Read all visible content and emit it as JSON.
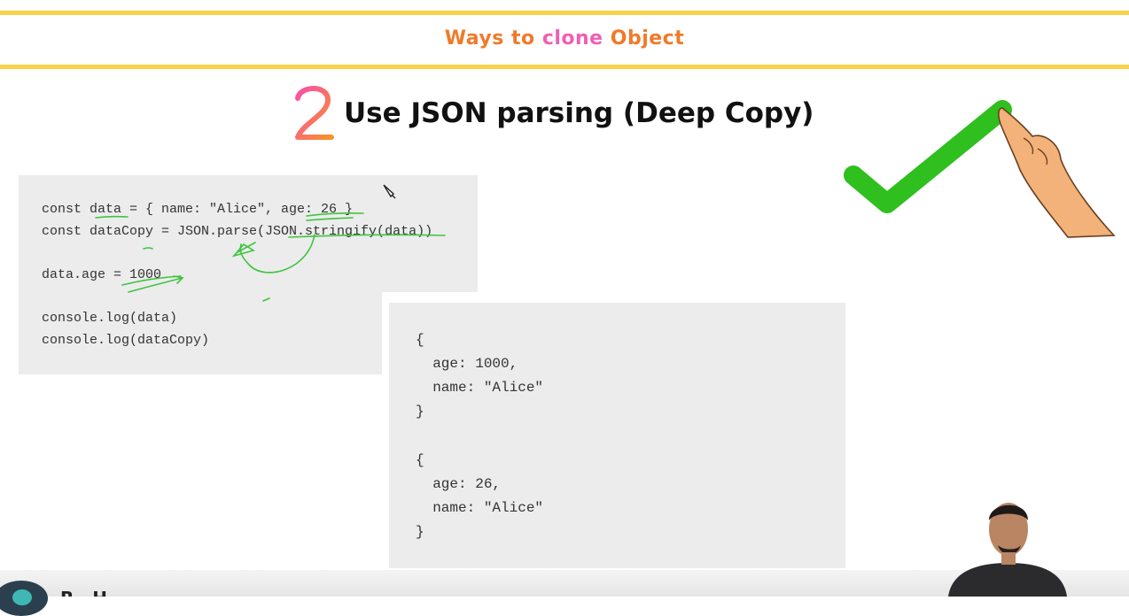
{
  "header": {
    "title_pre": "Ways to ",
    "title_accent": "clone",
    "title_post": " Object"
  },
  "slide": {
    "number_icon": "number-two-icon",
    "heading": "Use JSON parsing (Deep Copy)"
  },
  "code": {
    "lines": [
      "const data = { name: \"Alice\", age: 26 }",
      "const dataCopy = JSON.parse(JSON.stringify(data))",
      "data.age = 1000",
      "console.log(data)",
      "console.log(dataCopy)"
    ]
  },
  "output": {
    "lines": [
      "{",
      "  age: 1000,",
      "  name: \"Alice\"",
      "}",
      "{",
      "  age: 26,",
      "  name: \"Alice\"",
      "}"
    ]
  },
  "decor": {
    "checkmark_icon": "checkmark-icon",
    "hand_icon": "pointing-hand-icon",
    "annotation_color": "#3ec43e",
    "accent_orange": "#f07a2a",
    "accent_pink": "#ef5fb4",
    "bar_yellow": "#f7d24a"
  },
  "footer": {
    "channel_name": "R           H"
  }
}
